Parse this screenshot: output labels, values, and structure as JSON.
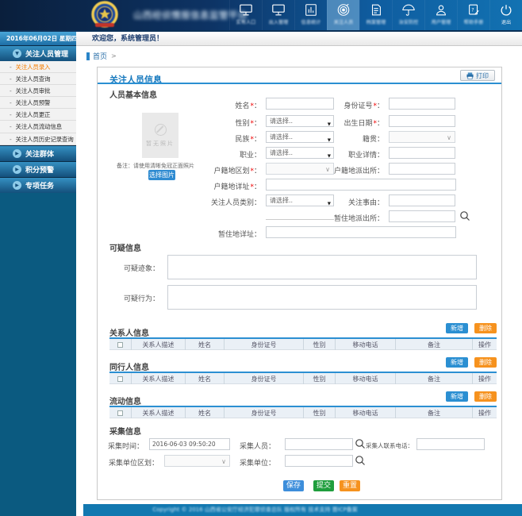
{
  "header": {
    "title": "山西经侦情报信息监管平台",
    "nav": [
      {
        "label": "实有人口",
        "icon": "monitor"
      },
      {
        "label": "出入管理",
        "icon": "monitor"
      },
      {
        "label": "信息统计",
        "icon": "chart"
      },
      {
        "label": "关注人员",
        "icon": "target",
        "active": true
      },
      {
        "label": "档案管理",
        "icon": "document"
      },
      {
        "label": "治安防控",
        "icon": "umbrella"
      },
      {
        "label": "用户管理",
        "icon": "user"
      },
      {
        "label": "帮助手册",
        "icon": "help-doc"
      },
      {
        "label": "退出",
        "icon": "power"
      }
    ]
  },
  "sidebar": {
    "date": "2016年06月02日 星期四",
    "group_title": "关注人员管理",
    "menu": [
      {
        "label": "关注人员录入",
        "active": true
      },
      {
        "label": "关注人员查询"
      },
      {
        "label": "关注人员审批"
      },
      {
        "label": "关注人员预警"
      },
      {
        "label": "关注人员更正"
      },
      {
        "label": "关注人员流动信息"
      },
      {
        "label": "关注人员历史记录查询"
      }
    ],
    "groups": [
      "关注群体",
      "积分预警",
      "专项任务"
    ]
  },
  "welcome": "欢迎您，系统管理员！",
  "breadcrumb": {
    "home": "首页",
    "sep": ">"
  },
  "panel": {
    "title": "关注人员信息",
    "print": "打印"
  },
  "basic": {
    "section_title": "人员基本信息",
    "photo_text": "暂无照片",
    "photo_note": "备注：请使用清晰免冠正面照片",
    "choose_image": "选择图片",
    "placeholder_select": "请选择..",
    "f_name": "姓名",
    "f_id": "身份证号",
    "f_sex": "性别",
    "f_birth": "出生日期",
    "f_nation": "民族",
    "f_origin": "籍贯",
    "f_job": "职业",
    "f_jobdetail": "职业详情",
    "f_regdist": "户籍地区划",
    "f_regstation": "户籍地派出所",
    "f_regaddr": "户籍地详址",
    "f_type": "关注人员类别",
    "f_reason": "关注事由",
    "f_tempstation": "暂住地派出所",
    "f_tempaddr": "暂住地详址"
  },
  "suspicious": {
    "section_title": "可疑信息",
    "f_sign": "可疑迹象",
    "f_behavior": "可疑行为"
  },
  "tables": [
    {
      "title": "关系人信息",
      "add": "新增",
      "del": "删除",
      "headers": [
        "关系人描述",
        "姓名",
        "身份证号",
        "性别",
        "移动电话",
        "备注",
        "操作"
      ]
    },
    {
      "title": "同行人信息",
      "add": "新增",
      "del": "删除",
      "headers": [
        "关系人描述",
        "姓名",
        "身份证号",
        "性别",
        "移动电话",
        "备注",
        "操作"
      ]
    },
    {
      "title": "流动信息",
      "add": "新增",
      "del": "删除",
      "headers": [
        "关系人描述",
        "姓名",
        "身份证号",
        "性别",
        "移动电话",
        "备注",
        "操作"
      ]
    }
  ],
  "collect": {
    "section_title": "采集信息",
    "f_time": "采集时间",
    "time_value": "2016-06-03 09:50:20",
    "f_person": "采集人员",
    "f_phone": "采集人联系电话",
    "f_unitdist": "采集单位区划",
    "f_unit": "采集单位"
  },
  "actions": {
    "save": "保存",
    "submit": "提交",
    "reset": "重置"
  },
  "footer": {
    "text": "Copyright © 2016 山西省公安厅经济犯罪侦查总队 版权所有 技术支持 晋ICP备案"
  }
}
